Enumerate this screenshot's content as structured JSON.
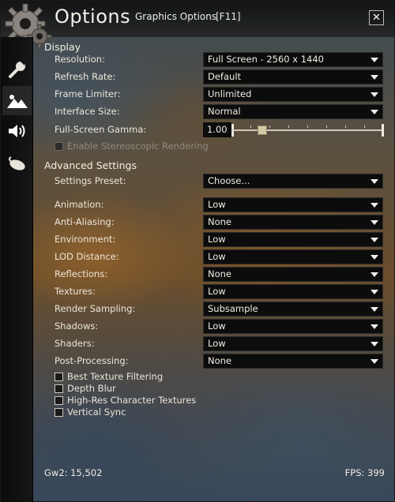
{
  "header": {
    "title": "Options",
    "subtitle": "Graphics Options",
    "hotkey": "[F11]",
    "close_label": "✕"
  },
  "sidebar": {
    "tabs": [
      {
        "name": "wrench-icon",
        "active": false
      },
      {
        "name": "mountains-icon",
        "active": true
      },
      {
        "name": "speaker-icon",
        "active": false
      },
      {
        "name": "mouse-icon",
        "active": false
      }
    ]
  },
  "display": {
    "title": "Display",
    "rows": [
      {
        "label": "Resolution:",
        "value": "Full Screen - 2560 x 1440"
      },
      {
        "label": "Refresh Rate:",
        "value": "Default"
      },
      {
        "label": "Frame Limiter:",
        "value": "Unlimited"
      },
      {
        "label": "Interface Size:",
        "value": "Normal"
      }
    ],
    "gamma_label": "Full-Screen Gamma:",
    "gamma_value": "1.00",
    "gamma_fraction": 0.2,
    "stereo_label": "Enable Stereoscopic Rendering"
  },
  "advanced": {
    "title": "Advanced Settings",
    "preset_label": "Settings Preset:",
    "preset_value": "Choose...",
    "rows": [
      {
        "label": "Animation:",
        "value": "Low"
      },
      {
        "label": "Anti-Aliasing:",
        "value": "None"
      },
      {
        "label": "Environment:",
        "value": "Low"
      },
      {
        "label": "LOD Distance:",
        "value": "Low"
      },
      {
        "label": "Reflections:",
        "value": "None"
      },
      {
        "label": "Textures:",
        "value": "Low"
      },
      {
        "label": "Render Sampling:",
        "value": "Subsample"
      },
      {
        "label": "Shadows:",
        "value": "Low"
      },
      {
        "label": "Shaders:",
        "value": "Low"
      },
      {
        "label": "Post-Processing:",
        "value": "None"
      }
    ],
    "checkboxes": [
      {
        "label": "Best Texture Filtering",
        "checked": false
      },
      {
        "label": "Depth Blur",
        "checked": false
      },
      {
        "label": "High-Res Character Textures",
        "checked": false
      },
      {
        "label": "Vertical Sync",
        "checked": false
      }
    ]
  },
  "footer": {
    "build": "Gw2: 15,502",
    "fps": "FPS: 399"
  }
}
